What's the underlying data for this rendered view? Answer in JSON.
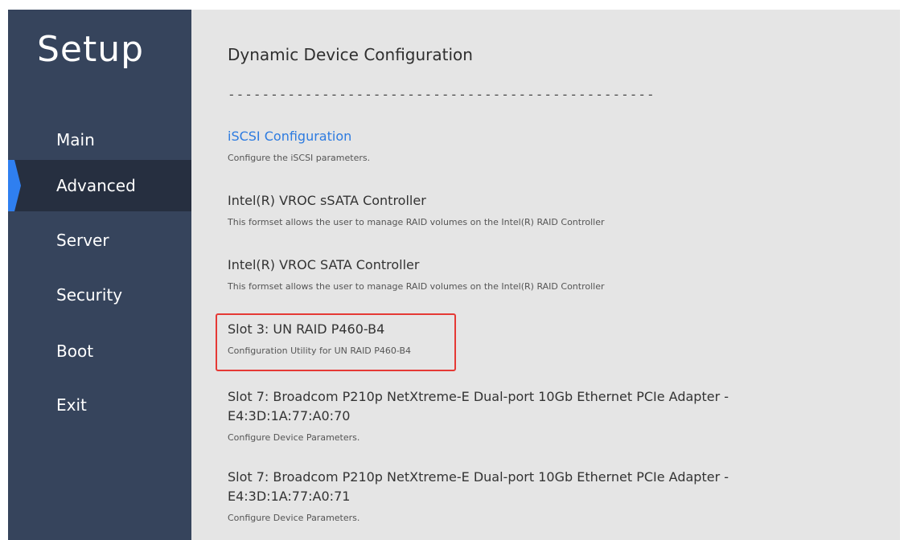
{
  "sidebar": {
    "title": "Setup",
    "items": [
      {
        "label": "Main"
      },
      {
        "label": "Advanced"
      },
      {
        "label": "Server"
      },
      {
        "label": "Security"
      },
      {
        "label": "Boot"
      },
      {
        "label": "Exit"
      }
    ],
    "active_item": "Advanced",
    "colors": {
      "background": "#36445c",
      "active": "#262f40",
      "marker": "#2f7ff0"
    }
  },
  "main": {
    "title": "Dynamic Device Configuration",
    "separator": "--------------------------------------------------",
    "items": [
      {
        "title": "iSCSI Configuration",
        "desc": "Configure the iSCSI parameters."
      },
      {
        "title": "Intel(R) VROC sSATA Controller",
        "desc": "This formset allows the user to manage RAID volumes on the Intel(R) RAID Controller"
      },
      {
        "title": "Intel(R) VROC SATA Controller",
        "desc": "This formset allows the user to manage RAID volumes on the Intel(R) RAID Controller"
      },
      {
        "title": "Slot 3: UN RAID P460-B4",
        "desc": "Configuration Utility for UN RAID P460-B4"
      },
      {
        "title": "Slot 7: Broadcom P210p NetXtreme-E Dual-port 10Gb Ethernet PCIe Adapter -",
        "title_line2": "E4:3D:1A:77:A0:70",
        "desc": "Configure Device Parameters."
      },
      {
        "title": "Slot 7: Broadcom P210p NetXtreme-E Dual-port 10Gb Ethernet PCIe Adapter -",
        "title_line2": "E4:3D:1A:77:A0:71",
        "desc": "Configure Device Parameters."
      }
    ],
    "colors": {
      "link": "#2d7be0",
      "highlight_border": "#e53935"
    }
  }
}
